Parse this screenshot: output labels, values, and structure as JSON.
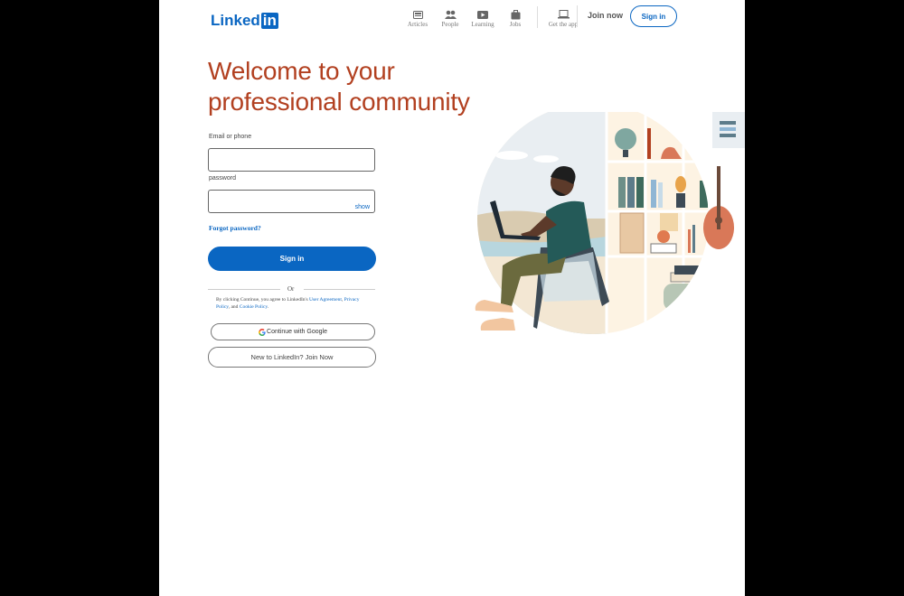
{
  "header": {
    "logo_text": "Linked",
    "logo_box_text": "in",
    "nav": [
      {
        "label": "Articles",
        "icon": "articles-icon"
      },
      {
        "label": "People",
        "icon": "people-icon"
      },
      {
        "label": "Learning",
        "icon": "learning-icon"
      },
      {
        "label": "Jobs",
        "icon": "jobs-icon"
      }
    ],
    "get_app": {
      "label": "Get the app",
      "icon": "laptop-icon"
    },
    "join_now": "Join now",
    "sign_in": "Sign in"
  },
  "main": {
    "title": "Welcome to your professional community",
    "email_label": "Email or phone",
    "email_value": "",
    "password_label": "password",
    "password_value": "",
    "show_label": "show",
    "forgot": "Forgot password?",
    "sign_in_button": "Sign in",
    "or": "Or",
    "terms_prefix": "By clicking Continue, you agree to LinkedIn's",
    "terms_user_agreement": "User Agreement",
    "terms_privacy": "Privacy Policy",
    "terms_and": ", and",
    "terms_cookie": "Cookie Policy",
    "google_button": "Continue with Google",
    "join_button": "New to LinkedIn? Join Now"
  },
  "colors": {
    "brand": "#0a66c2",
    "headline": "#b24020"
  }
}
